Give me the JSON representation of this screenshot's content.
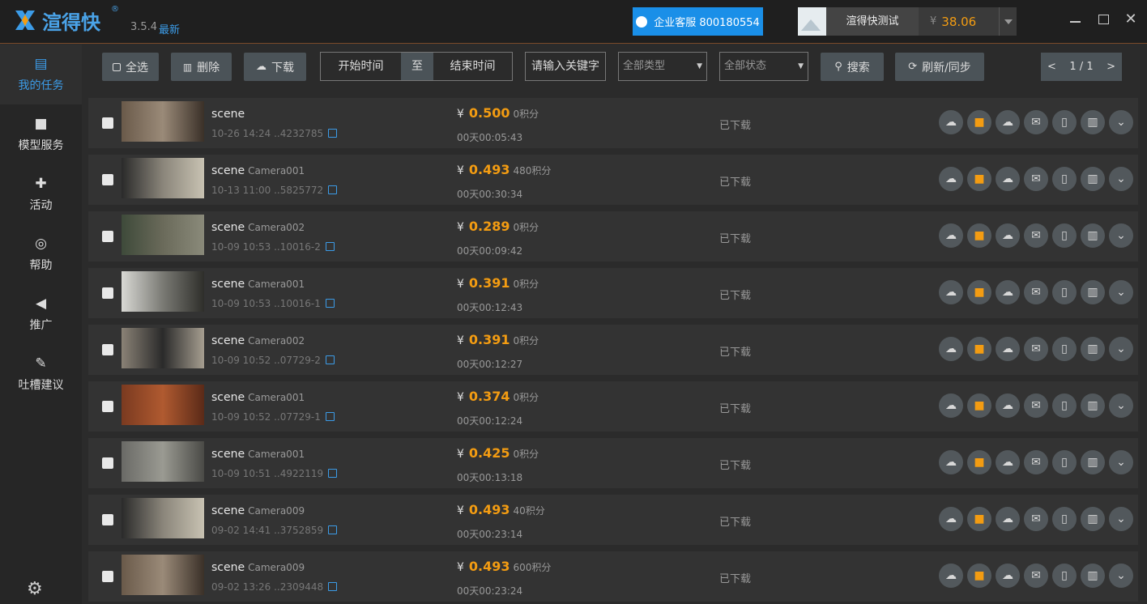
{
  "app": {
    "name": "渲得快",
    "reg": "®",
    "version": "3.5.4",
    "latest": "最新"
  },
  "support": {
    "label": "企业客服 800180554"
  },
  "user": {
    "name": "渲得快测试",
    "currency": "¥",
    "balance": "38.06"
  },
  "window": {
    "minimize": "",
    "maximize": "",
    "close": "✕"
  },
  "sidebar": {
    "items": [
      {
        "label": "我的任务",
        "icon": "task-list-icon",
        "glyph": "▤"
      },
      {
        "label": "模型服务",
        "icon": "briefcase-icon",
        "glyph": "■"
      },
      {
        "label": "活动",
        "icon": "gift-icon",
        "glyph": "✚"
      },
      {
        "label": "帮助",
        "icon": "compass-icon",
        "glyph": "◎"
      },
      {
        "label": "推广",
        "icon": "megaphone-icon",
        "glyph": "◀"
      },
      {
        "label": "吐槽建议",
        "icon": "edit-icon",
        "glyph": "✎"
      }
    ],
    "settings_glyph": "⚙"
  },
  "toolbar": {
    "select_all": "全选",
    "delete": "删除",
    "download": "下载",
    "start_time": "开始时间",
    "to": "至",
    "end_time": "结束时间",
    "keyword_placeholder": "请输入关键字",
    "type_select": "全部类型",
    "status_select": "全部状态",
    "search": "搜索",
    "refresh": "刷新/同步",
    "page_prev": "<",
    "page": "1 / 1",
    "page_next": ">"
  },
  "tasks": [
    {
      "name": "scene",
      "camera": "",
      "date": "10-26 14:24",
      "id": "..4232785",
      "price": "0.500",
      "points": "0积分",
      "duration": "00天00:05:43",
      "status": "已下载",
      "thumb": [
        "#6a5a4a",
        "#9a8a78",
        "#3a3028"
      ]
    },
    {
      "name": "scene",
      "camera": "Camera001",
      "date": "10-13 11:00",
      "id": "..5825772",
      "price": "0.493",
      "points": "480积分",
      "duration": "00天00:30:34",
      "status": "已下载",
      "thumb": [
        "#2a2a2a",
        "#8a857a",
        "#c8c2b2"
      ]
    },
    {
      "name": "scene",
      "camera": "Camera002",
      "date": "10-09 10:53",
      "id": "..10016-2",
      "price": "0.289",
      "points": "0积分",
      "duration": "00天00:09:42",
      "status": "已下载",
      "thumb": [
        "#3e4a3a",
        "#6a6a5a",
        "#8a8a7a"
      ]
    },
    {
      "name": "scene",
      "camera": "Camera001",
      "date": "10-09 10:53",
      "id": "..10016-1",
      "price": "0.391",
      "points": "0积分",
      "duration": "00天00:12:43",
      "status": "已下载",
      "thumb": [
        "#d8d8d4",
        "#7a7a74",
        "#2e2e2a"
      ]
    },
    {
      "name": "scene",
      "camera": "Camera002",
      "date": "10-09 10:52",
      "id": "..07729-2",
      "price": "0.391",
      "points": "0积分",
      "duration": "00天00:12:27",
      "status": "已下载",
      "thumb": [
        "#8a8276",
        "#2a2a2a",
        "#a69e90"
      ]
    },
    {
      "name": "scene",
      "camera": "Camera001",
      "date": "10-09 10:52",
      "id": "..07729-1",
      "price": "0.374",
      "points": "0积分",
      "duration": "00天00:12:24",
      "status": "已下载",
      "thumb": [
        "#7a3a20",
        "#b05a30",
        "#5a2a18"
      ]
    },
    {
      "name": "scene",
      "camera": "Camera001",
      "date": "10-09 10:51",
      "id": "..4922119",
      "price": "0.425",
      "points": "0积分",
      "duration": "00天00:13:18",
      "status": "已下载",
      "thumb": [
        "#6a6a66",
        "#9a9a92",
        "#4a4a46"
      ]
    },
    {
      "name": "scene",
      "camera": "Camera009",
      "date": "09-02 14:41",
      "id": "..3752859",
      "price": "0.493",
      "points": "40积分",
      "duration": "00天00:23:14",
      "status": "已下载",
      "thumb": [
        "#2a2a2a",
        "#8a857a",
        "#c8c2b2"
      ]
    },
    {
      "name": "scene",
      "camera": "Camera009",
      "date": "09-02 13:26",
      "id": "..2309448",
      "price": "0.493",
      "points": "600积分",
      "duration": "00天00:23:24",
      "status": "已下载",
      "thumb": [
        "#6a5a4a",
        "#9a8a78",
        "#3a3028"
      ]
    }
  ],
  "actions": [
    {
      "name": "cloud-upload-icon",
      "glyph": "☁"
    },
    {
      "name": "folder-icon",
      "glyph": "■"
    },
    {
      "name": "cloud-download-icon",
      "glyph": "☁"
    },
    {
      "name": "envelope-icon",
      "glyph": "✉"
    },
    {
      "name": "file-icon",
      "glyph": "▯"
    },
    {
      "name": "trash-icon",
      "glyph": "▥"
    },
    {
      "name": "chevron-down-icon",
      "glyph": "⌄"
    }
  ]
}
